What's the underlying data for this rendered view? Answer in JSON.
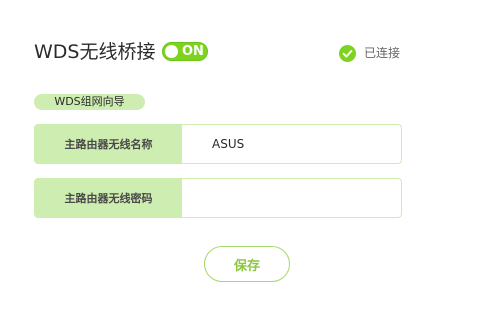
{
  "header": {
    "title": "WDS无线桥接",
    "toggle_label": "ON",
    "status_text": "已连接",
    "status_icon": "check-circle-icon"
  },
  "wizard": {
    "label": "WDS组网向导"
  },
  "form": {
    "ssid_label": "主路由器无线名称",
    "ssid_value": "ASUS",
    "password_label": "主路由器无线密码",
    "password_value": ""
  },
  "actions": {
    "save_label": "保存"
  },
  "colors": {
    "accent": "#7ed321",
    "accent_light": "#cdeeb0",
    "button_text": "#8dc63f"
  }
}
